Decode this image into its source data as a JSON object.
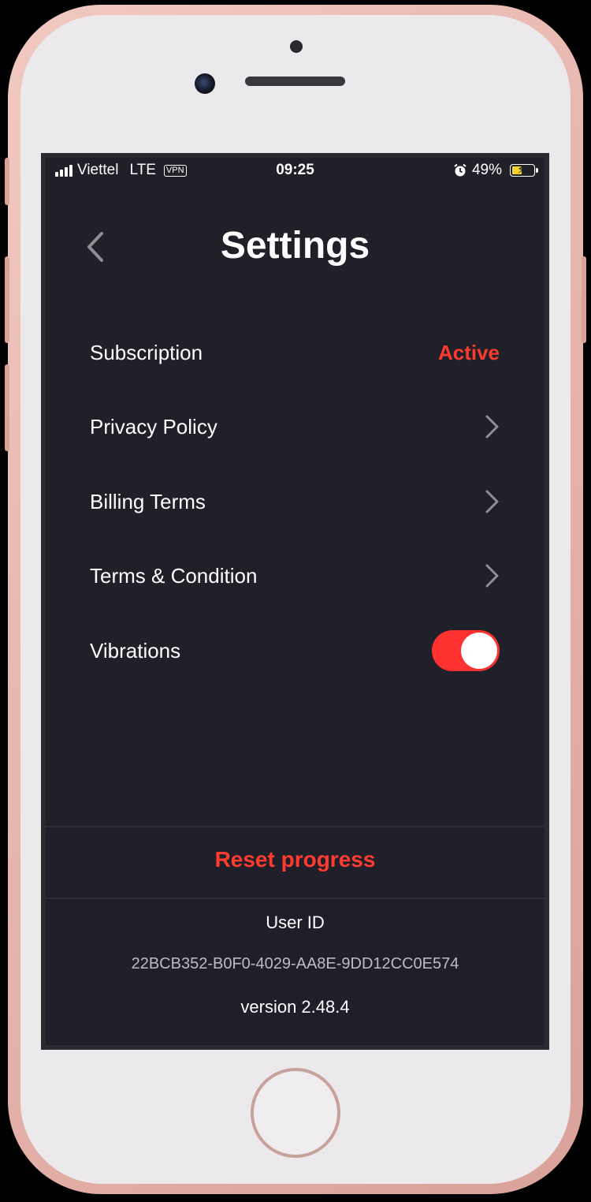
{
  "status_bar": {
    "carrier": "Viettel",
    "network": "LTE",
    "vpn": "VPN",
    "time": "09:25",
    "battery_percent": "49%",
    "battery_level": 0.49
  },
  "header": {
    "title": "Settings"
  },
  "settings": {
    "subscription": {
      "label": "Subscription",
      "value": "Active"
    },
    "privacy": {
      "label": "Privacy Policy"
    },
    "billing": {
      "label": "Billing Terms"
    },
    "terms": {
      "label": "Terms & Condition"
    },
    "vibrations": {
      "label": "Vibrations",
      "enabled": true
    }
  },
  "reset": {
    "label": "Reset progress"
  },
  "info": {
    "user_id_label": "User ID",
    "user_id": "22BCB352-B0F0-4029-AA8E-9DD12CC0E574",
    "version": "version 2.48.4"
  },
  "colors": {
    "accent": "#ff3b30",
    "screen_bg": "#202029",
    "frame": "#ebe9ec"
  }
}
